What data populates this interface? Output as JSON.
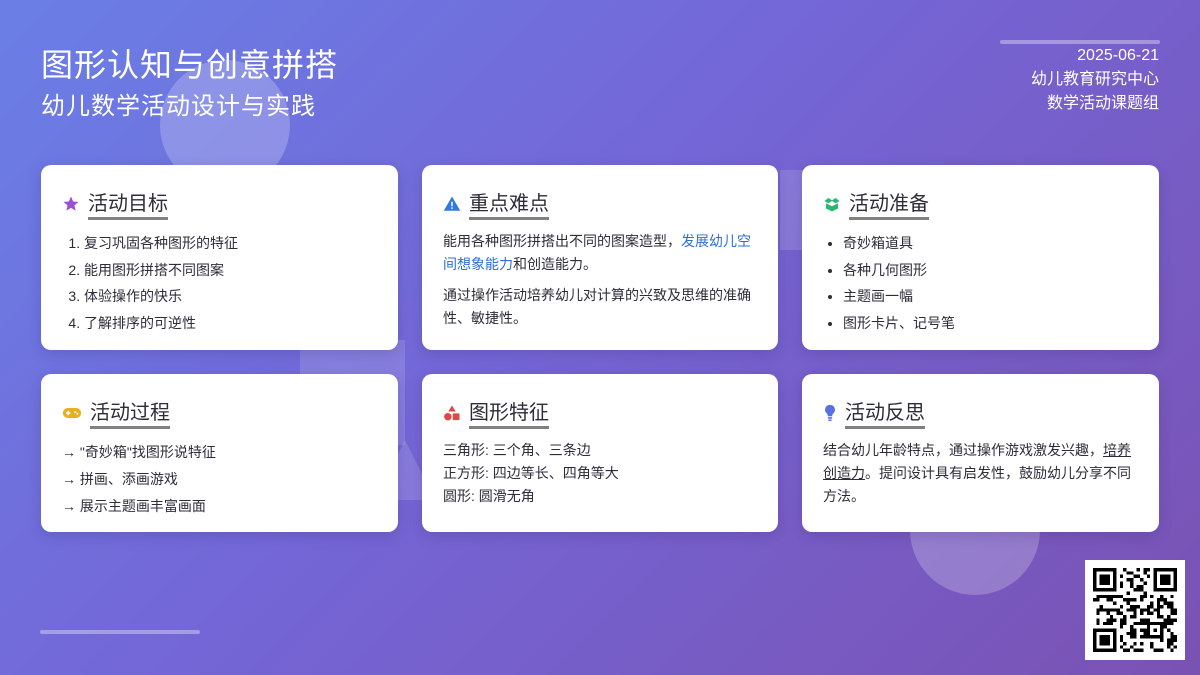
{
  "header": {
    "title": "图形认知与创意拼搭",
    "subtitle": "幼儿数学活动设计与实践",
    "date": "2025-06-21",
    "org": "幼儿教育研究中心",
    "group": "数学活动课题组"
  },
  "cards": {
    "goals": {
      "icon": "star-icon",
      "title": "活动目标",
      "items": [
        "复习巩固各种图形的特征",
        "能用图形拼搭不同图案",
        "体验操作的快乐",
        "了解排序的可逆性"
      ]
    },
    "difficulties": {
      "icon": "warning-icon",
      "title": "重点难点",
      "p1_before": "能用各种图形拼搭出不同的图案造型，",
      "p1_highlight": "发展幼儿空间想象能力",
      "p1_after": "和创造能力。",
      "p2": "通过操作活动培养幼儿对计算的兴致及思维的准确性、敏捷性。"
    },
    "preparation": {
      "icon": "box-icon",
      "title": "活动准备",
      "items": [
        "奇妙箱道具",
        "各种几何图形",
        "主题画一幅",
        "图形卡片、记号笔"
      ]
    },
    "process": {
      "icon": "gamepad-icon",
      "title": "活动过程",
      "items": [
        "→ \"奇妙箱\"找图形说特征",
        "→ 拼画、添画游戏",
        "→ 展示主题画丰富画面"
      ]
    },
    "features": {
      "icon": "shapes-icon",
      "title": "图形特征",
      "items": [
        "三角形: 三个角、三条边",
        "正方形: 四边等长、四角等大",
        "圆形: 圆滑无角"
      ]
    },
    "reflection": {
      "icon": "lightbulb-icon",
      "title": "活动反思",
      "p_before": "结合幼儿年龄特点，通过操作游戏激发兴趣，",
      "p_underline": "培养创造力",
      "p_after": "。提问设计具有启发性，鼓励幼儿分享不同方法。"
    }
  },
  "colors": {
    "star": "#9b4fd6",
    "warning": "#2f7ae0",
    "box": "#2bb673",
    "gamepad": "#e8b020",
    "shapes": "#e04848",
    "bulb": "#5a6fe0"
  }
}
